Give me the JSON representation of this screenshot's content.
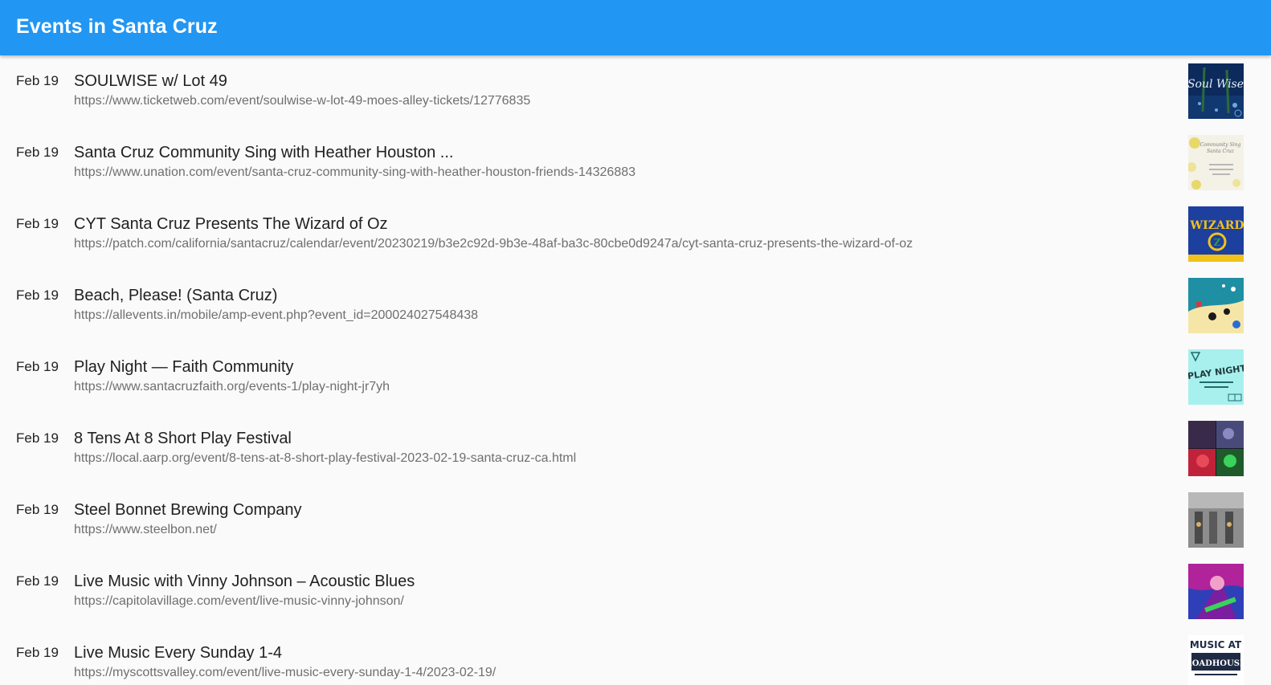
{
  "header": {
    "title": "Events in Santa Cruz"
  },
  "events": [
    {
      "date": "Feb 19",
      "title": "SOULWISE w/ Lot 49",
      "url": "https://www.ticketweb.com/event/soulwise-w-lot-49-moes-alley-tickets/12776835",
      "thumb_text": "Soul Wise",
      "thumb_colors": [
        "#0d2a5c",
        "#2b6b3a"
      ]
    },
    {
      "date": "Feb 19",
      "title": "Santa Cruz Community Sing with Heather Houston ...",
      "url": "https://www.unation.com/event/santa-cruz-community-sing-with-heather-houston-friends-14326883",
      "thumb_text": "Community Sing Santa Cruz",
      "thumb_colors": [
        "#f4f1e6",
        "#e8d86a"
      ]
    },
    {
      "date": "Feb 19",
      "title": "CYT Santa Cruz Presents The Wizard of Oz",
      "url": "https://patch.com/california/santacruz/calendar/event/20230219/b3e2c92d-9b3e-48af-ba3c-80cbe0d9247a/cyt-santa-cruz-presents-the-wizard-of-oz",
      "thumb_text": "WIZARD OZ",
      "thumb_colors": [
        "#1d3f9e",
        "#f2c21b"
      ]
    },
    {
      "date": "Feb 19",
      "title": "Beach, Please! (Santa Cruz)",
      "url": "https://allevents.in/mobile/amp-event.php?event_id=200024027548438",
      "thumb_text": "",
      "thumb_colors": [
        "#1f8fa3",
        "#f5e6a8"
      ]
    },
    {
      "date": "Feb 19",
      "title": "Play Night — Faith Community",
      "url": "https://www.santacruzfaith.org/events-1/play-night-jr7yh",
      "thumb_text": "PLAY NIGHT",
      "thumb_colors": [
        "#a8f0ee",
        "#1d6b6b"
      ]
    },
    {
      "date": "Feb 19",
      "title": "8 Tens At 8 Short Play Festival",
      "url": "https://local.aarp.org/event/8-tens-at-8-short-play-festival-2023-02-19-santa-cruz-ca.html",
      "thumb_text": "",
      "thumb_colors": [
        "#1a1a2e",
        "#c0223a"
      ]
    },
    {
      "date": "Feb 19",
      "title": "Steel Bonnet Brewing Company",
      "url": "https://www.steelbon.net/",
      "thumb_text": "",
      "thumb_colors": [
        "#8d8d8d",
        "#4a4a4a"
      ]
    },
    {
      "date": "Feb 19",
      "title": "Live Music with Vinny Johnson – Acoustic Blues",
      "url": "https://capitolavillage.com/event/live-music-vinny-johnson/",
      "thumb_text": "",
      "thumb_colors": [
        "#b0239b",
        "#2f3fb8"
      ]
    },
    {
      "date": "Feb 19",
      "title": "Live Music Every Sunday 1-4",
      "url": "https://myscottsvalley.com/event/live-music-every-sunday-1-4/2023-02-19/",
      "thumb_text": "MUSIC AT ROADHOUSE",
      "thumb_colors": [
        "#ffffff",
        "#1f2a44"
      ]
    }
  ]
}
